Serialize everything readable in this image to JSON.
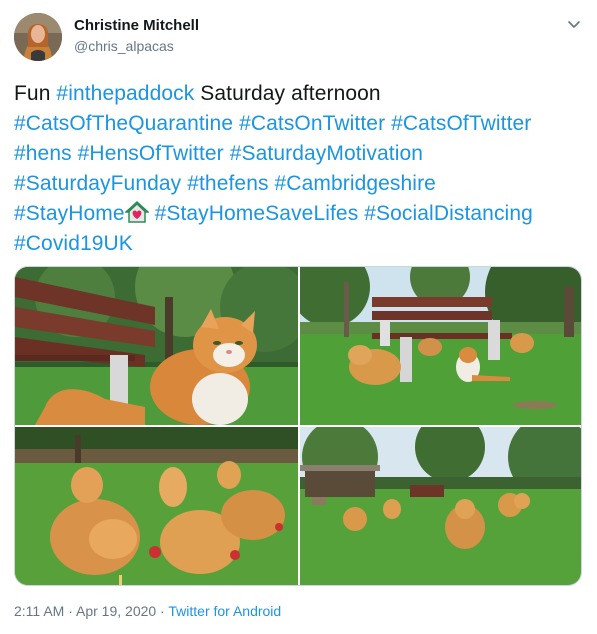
{
  "author": {
    "name": "Christine Mitchell",
    "handle": "@chris_alpacas"
  },
  "tweet": {
    "line1": {
      "plain": "Fun ",
      "tag": "#inthepaddock",
      "rest": " Saturday afternoon"
    },
    "line2": [
      "#CatsOfTheQuarantine",
      "#CatsOnTwitter",
      "#CatsOfTwitter"
    ],
    "line3": [
      "#hens",
      "#HensOfTwitter",
      "#SaturdayMotivation"
    ],
    "line4": [
      "#SaturdayFunday",
      "#thefens",
      "#Cambridgeshire"
    ],
    "line5": [
      "#StayHome",
      "#StayHomeSaveLifes",
      "#SocialDistancing"
    ],
    "line6": [
      "#Covid19UK"
    ]
  },
  "footer": {
    "time": "2:11 AM",
    "separator1": " · ",
    "date": "Apr 19, 2020",
    "separator2": " · ",
    "source": "Twitter for Android"
  },
  "colors": {
    "link": "#1b95e0",
    "text": "#14171a",
    "secondary": "#657786"
  },
  "icons": {
    "caret": "chevron-down-icon",
    "stay_home_emoji": "house-with-heart-emoji"
  }
}
